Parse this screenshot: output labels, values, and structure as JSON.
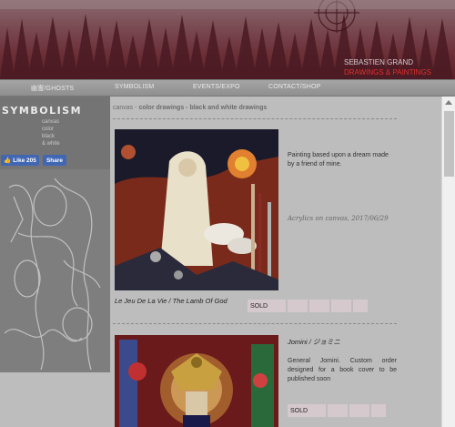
{
  "banner": {
    "line1": "SEBASTIEN GRAND",
    "line2": "DRAWINGS & PAINTINGS"
  },
  "nav": [
    {
      "label": "幽霊/GHOSTS"
    },
    {
      "label": "SYMBOLISM"
    },
    {
      "label": "EVENTS/EXPO"
    },
    {
      "label": "CONTACT/SHOP"
    }
  ],
  "sidebar": {
    "title": "SYMBOLISM",
    "links": [
      "canvas",
      "color",
      "black",
      "& white"
    ],
    "fb_like": "Like 205",
    "fb_share": "Share"
  },
  "categories": {
    "first": "canvas",
    "separator": "-",
    "rest": "color drawings - black and white drawings"
  },
  "items": [
    {
      "description": "Painting based upon a dream made by a friend of mine.",
      "meta": "Acrylics on canvas, 2017/06/29",
      "title": "Le Jeu De La Vie / The Lamb Of God",
      "status": "SOLD"
    },
    {
      "title_jp": "Jomini / ジョミニ",
      "description": "General Jomini. Custom order designed for a book cover to be published soon",
      "status": "SOLD"
    }
  ]
}
